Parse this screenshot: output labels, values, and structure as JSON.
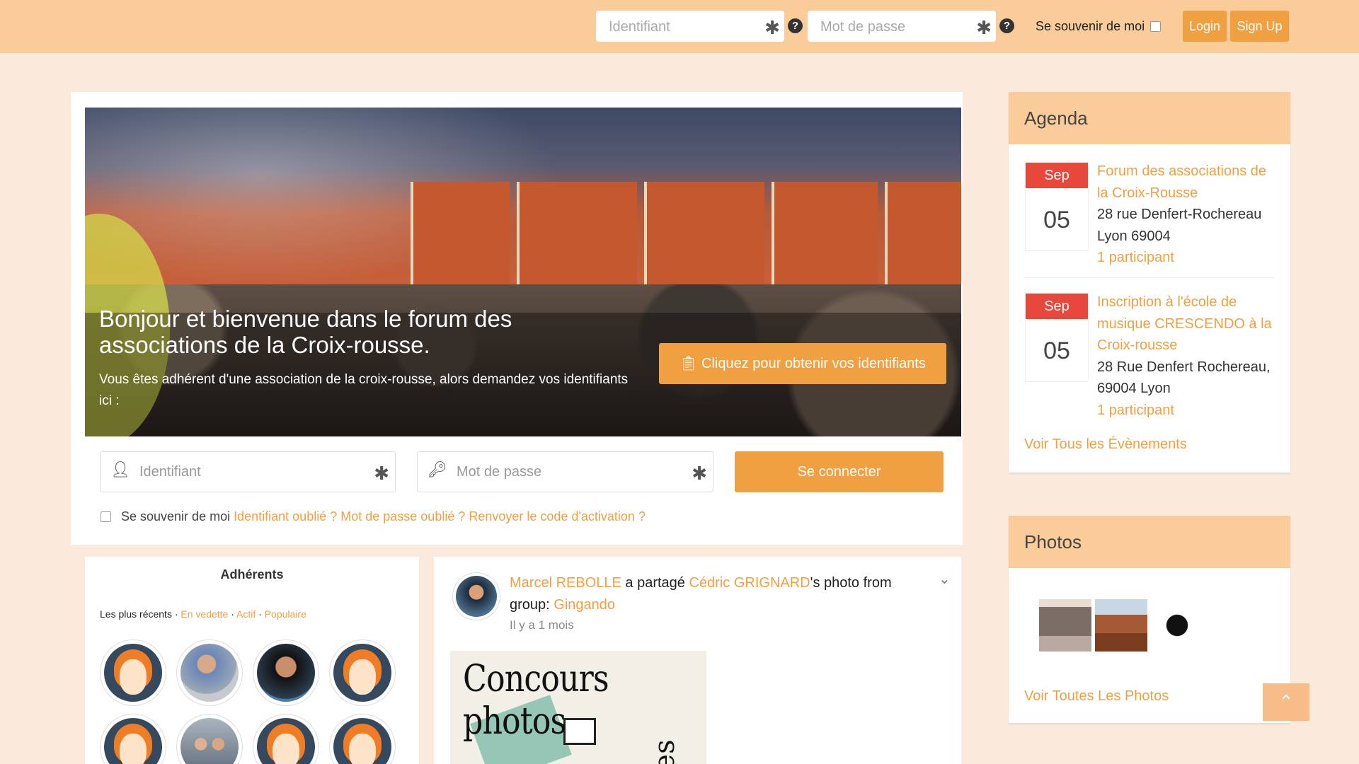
{
  "topbar": {
    "username_placeholder": "Identifiant",
    "password_placeholder": "Mot de passe",
    "remember_label": "Se souvenir de moi",
    "login_label": "Login",
    "signup_label": "Sign Up"
  },
  "hero": {
    "title": "Bonjour et bienvenue dans le forum des associations de la Croix-rousse.",
    "subtitle": "Vous êtes adhérent d'une association de la croix-rousse, alors demandez vos identifiants ici :",
    "cta_label": "Cliquez pour obtenir vos identifiants"
  },
  "login": {
    "username_placeholder": "Identifiant",
    "password_placeholder": "Mot de passe",
    "submit_label": "Se connecter",
    "remember_label": "Se souvenir de moi",
    "forgot_username": "Identifiant oublié ?",
    "forgot_password": "Mot de passe oublié ?",
    "resend_activation": "Renvoyer le code d'activation ?"
  },
  "members": {
    "title": "Adhérents",
    "tab_recent": "Les plus récents",
    "tab_featured": "En vedette",
    "tab_active": "Actif",
    "tab_popular": "Populaire",
    "separator": "·"
  },
  "activity": {
    "actor": "Marcel REBOLLE",
    "verb": "a partagé",
    "target": "Cédric GRIGNARD",
    "suffix": "'s photo from group:",
    "group": "Gingando",
    "time": "Il y a 1 mois",
    "image_text": "Concours photos",
    "image_side_text": "ces !"
  },
  "agenda": {
    "title": "Agenda",
    "events": [
      {
        "month": "Sep",
        "day": "05",
        "title": "Forum des associations de la Croix-Rousse",
        "address": "28 rue Denfert-Rochereau Lyon 69004",
        "participants": "1 participant"
      },
      {
        "month": "Sep",
        "day": "05",
        "title": "Inscription à l'école de musique CRESCENDO à la Croix-rousse",
        "address": "28 Rue Denfert Rochereau, 69004 Lyon",
        "participants": "1 participant"
      }
    ],
    "see_all": "Voir Tous les Évènements"
  },
  "photos": {
    "title": "Photos",
    "see_all": "Voir Toutes Les Photos"
  },
  "icons": {
    "required": "asterisk-icon",
    "help": "question-circle-icon",
    "user": "user-icon",
    "key": "key-icon",
    "clipboard": "clipboard-check-icon",
    "chevron": "chevron-down-icon",
    "to_top": "chevron-up-icon"
  },
  "colors": {
    "accent": "#f0a040",
    "topbar": "#f9cc9a",
    "background": "#fbeadb",
    "date_red": "#e8473b"
  }
}
